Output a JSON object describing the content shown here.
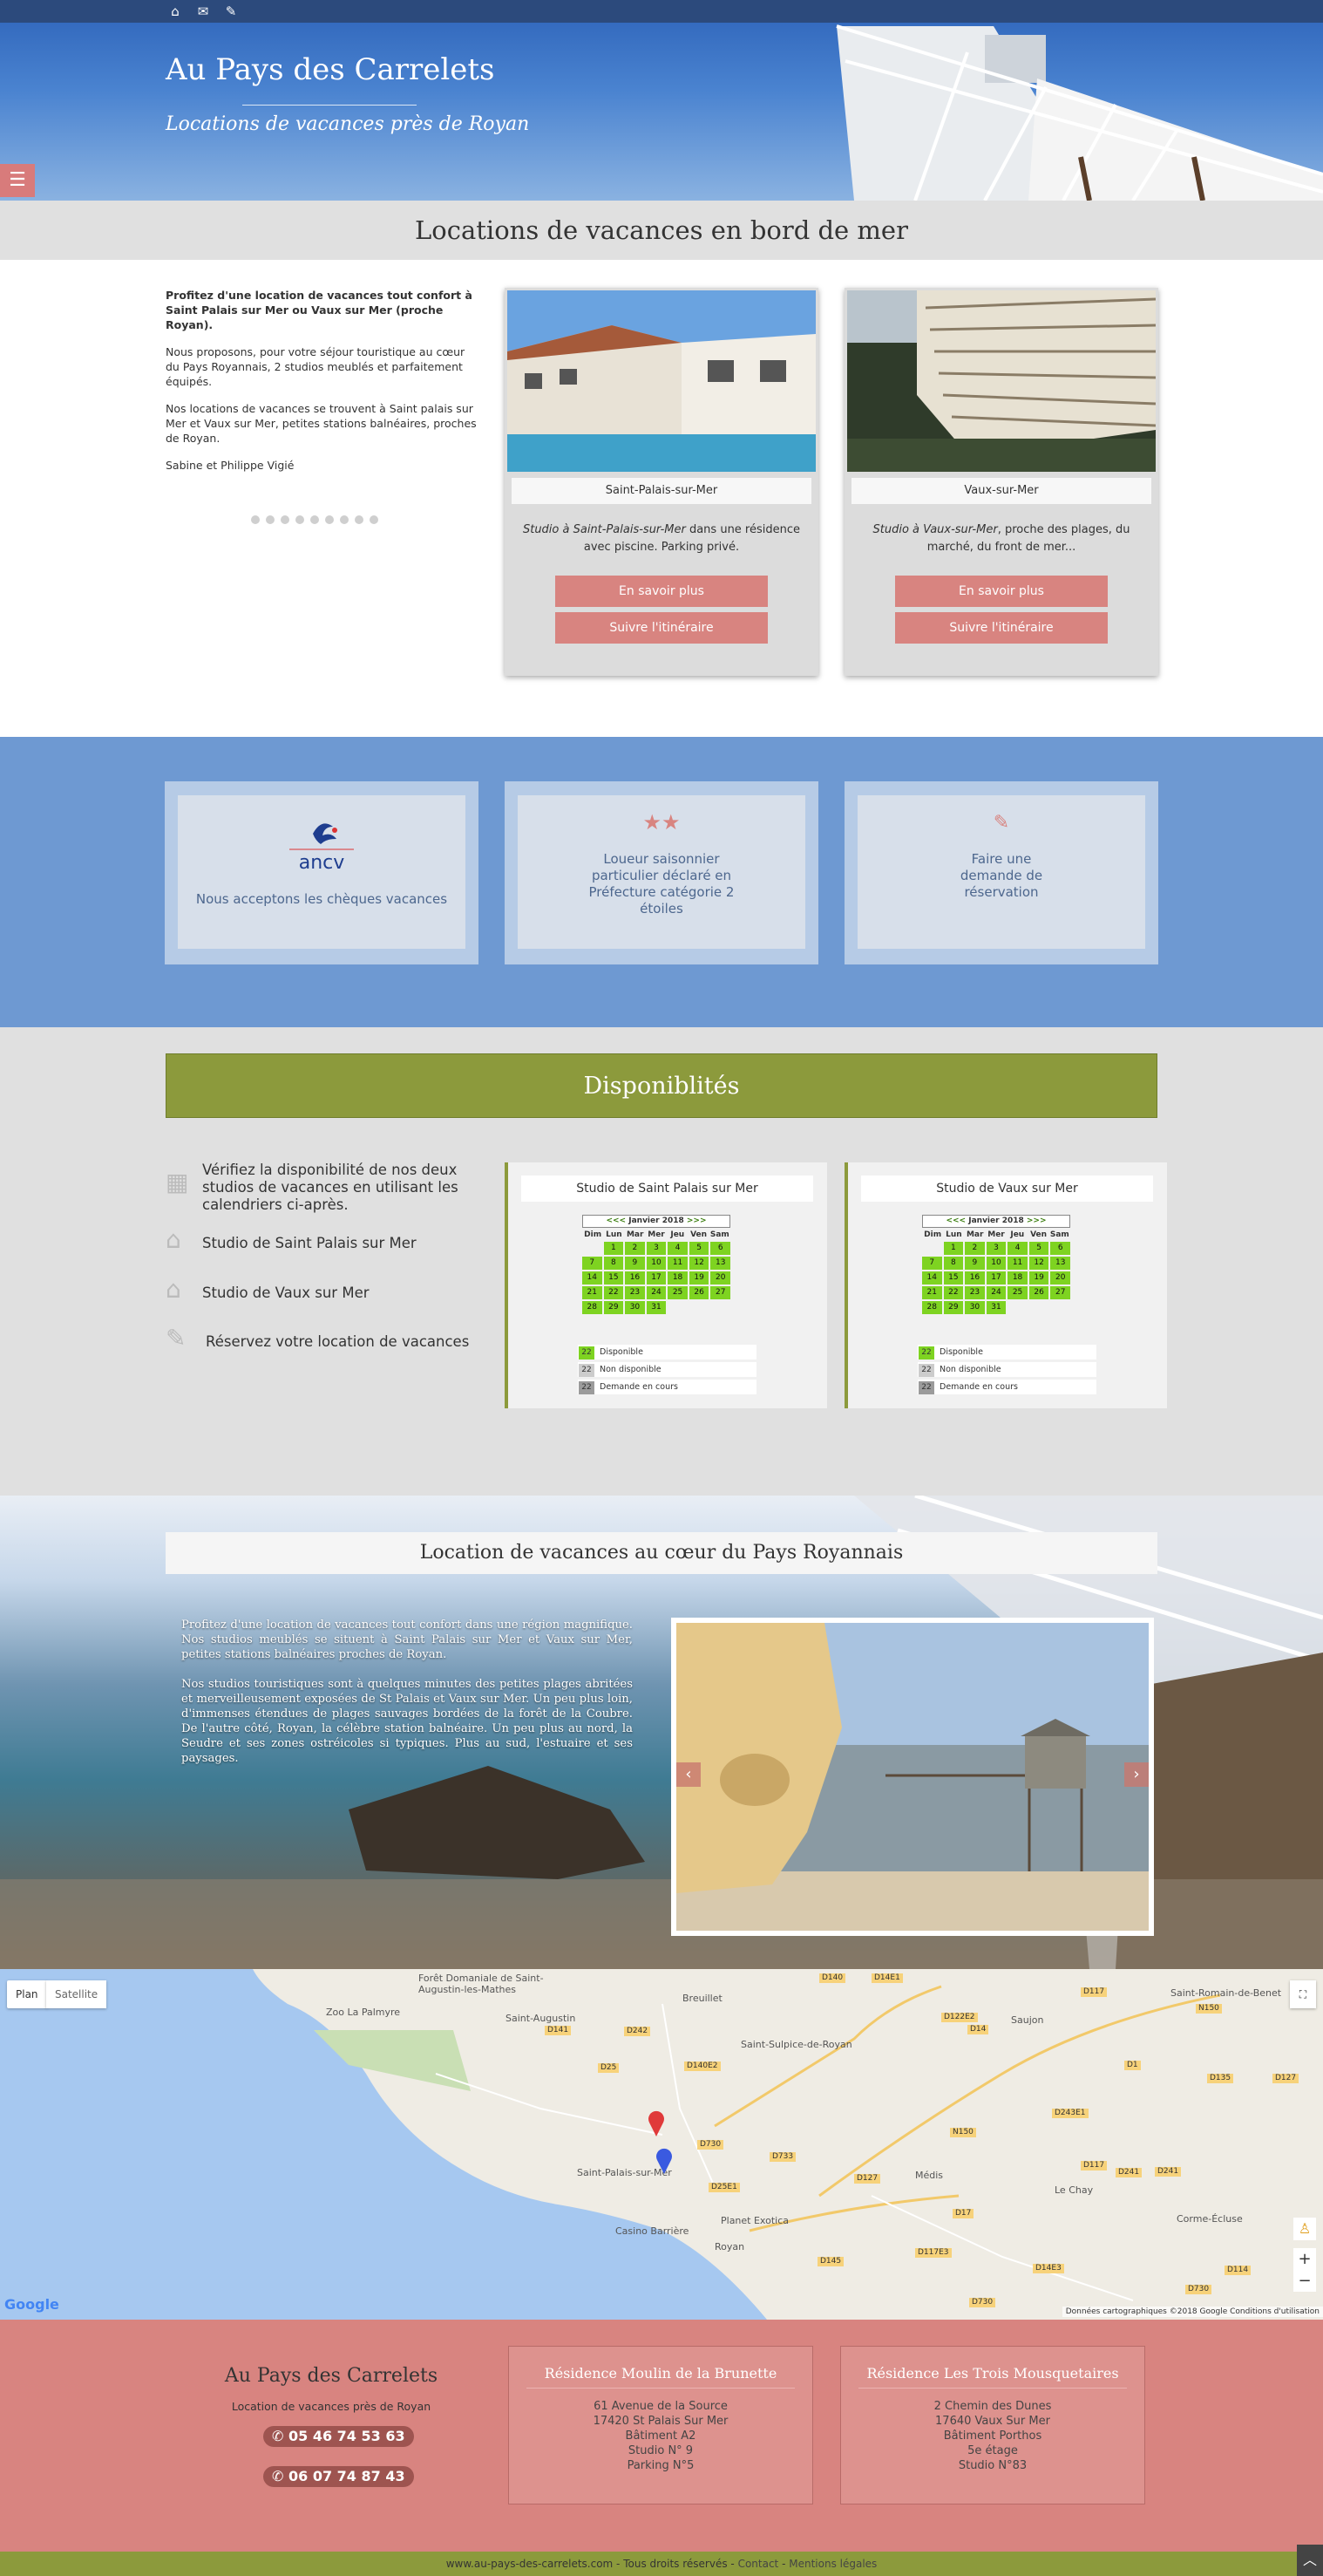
{
  "topbar": {
    "icons": [
      "home-icon",
      "envelope-icon",
      "edit-icon"
    ]
  },
  "hero": {
    "title": "Au Pays des Carrelets",
    "subtitle": "Locations de vacances près de Royan",
    "menu_icon": "hamburger-icon"
  },
  "section1": {
    "title": "Locations de vacances en bord de mer",
    "intro_lead": "Profitez d'une location de vacances tout confort à Saint Palais sur Mer ou Vaux sur Mer (proche Royan).",
    "intro_p2": "Nous proposons, pour votre séjour touristique au cœur du Pays Royannais, 2 studios meublés et parfaitement équipés.",
    "intro_p3": "Nos locations de vacances se trouvent à Saint palais sur Mer et Vaux sur Mer, petites stations balnéaires, proches de Royan.",
    "signature": "Sabine et Philippe Vigié",
    "cards": [
      {
        "label": "Saint-Palais-sur-Mer",
        "desc_em": "Studio à Saint-Palais-sur-Mer",
        "desc": " dans une résidence avec piscine. Parking privé.",
        "btn1": "En savoir plus",
        "btn2": "Suivre l'itinéraire"
      },
      {
        "label": "Vaux-sur-Mer",
        "desc_em": "Studio à Vaux-sur-Mer",
        "desc": ", proche des plages, du marché, du front de mer...",
        "btn1": "En savoir plus",
        "btn2": "Suivre l'itinéraire"
      }
    ]
  },
  "section2": {
    "cards": [
      {
        "icon": "ancv-logo",
        "logo_text": "ancv",
        "text": "Nous acceptons les chèques vacances"
      },
      {
        "icon": "stars-icon",
        "text": "Loueur saisonnier particulier déclaré en Préfecture catégorie 2 étoiles"
      },
      {
        "icon": "edit-icon",
        "text": "Faire une demande de réservation"
      }
    ]
  },
  "section3": {
    "title": "Disponiblités",
    "items": [
      {
        "icon": "calendar-icon",
        "text": "Vérifiez la disponibilité de nos deux studios de vacances en utilisant les calendriers ci-après."
      },
      {
        "icon": "home-icon",
        "text": "Studio de Saint Palais sur Mer"
      },
      {
        "icon": "home-icon",
        "text": "Studio de Vaux sur Mer"
      },
      {
        "icon": "edit-icon",
        "text": "Réservez votre location de vacances"
      }
    ],
    "calendars": [
      {
        "title": "Studio de Saint Palais sur Mer",
        "prev": "<<<",
        "month": "Janvier 2018",
        "next": ">>>"
      },
      {
        "title": "Studio de Vaux sur Mer",
        "prev": "<<<",
        "month": "Janvier 2018",
        "next": ">>>"
      }
    ],
    "weekdays": [
      "Dim",
      "Lun",
      "Mar",
      "Mer",
      "Jeu",
      "Ven",
      "Sam"
    ],
    "legend": [
      {
        "num": "22",
        "label": "Disponible",
        "color": "#7ed321"
      },
      {
        "num": "22",
        "label": "Non disponible",
        "color": "#cccccc"
      },
      {
        "num": "22",
        "label": "Demande en cours",
        "color": "#9b9b9b"
      }
    ]
  },
  "section4": {
    "title": "Location de vacances au cœur du Pays Royannais",
    "p1": "Profitez d'une location de vacances tout confort dans une région magnifique. Nos studios meublés se situent à Saint Palais sur Mer et Vaux sur Mer, petites stations balnéaires proches de Royan.",
    "p2": "Nos studios touristiques sont à quelques minutes des petites plages abritées et merveilleusement exposées de St Palais et Vaux sur Mer. Un peu plus loin, d'immenses étendues de plages sauvages bordées de la forêt de la Coubre. De l'autre côté, Royan, la célèbre station balnéaire. Un peu plus au nord, la Seudre et ses zones ostréicoles si typiques. Plus au sud, l'estuaire et ses paysages.",
    "prev": "‹",
    "next": "›"
  },
  "map": {
    "plan": "Plan",
    "satellite": "Satellite",
    "places": [
      {
        "text": "Forêt Domaniale de Saint-Augustin-les-Mathes"
      },
      {
        "text": "Zoo La Palmyre"
      },
      {
        "text": "Saint-Augustin"
      },
      {
        "text": "Breuillet"
      },
      {
        "text": "Saint-Sulpice-de-Royan"
      },
      {
        "text": "Saujon"
      },
      {
        "text": "Saint-Romain-de-Benet"
      },
      {
        "text": "Saint-Palais-sur-Mer"
      },
      {
        "text": "Médis"
      },
      {
        "text": "Le Chay"
      },
      {
        "text": "Corme-Écluse"
      },
      {
        "text": "Planet Exotica"
      },
      {
        "text": "Casino Barrière"
      },
      {
        "text": "Royan"
      }
    ],
    "roads": [
      "D140",
      "D14E1",
      "D117",
      "N150",
      "D14",
      "D122E2",
      "D25",
      "D141",
      "D242",
      "D140E2",
      "D733",
      "N150",
      "D1",
      "D135",
      "D127",
      "D243E1",
      "D117",
      "D241",
      "D241",
      "D17",
      "D117E3",
      "D114",
      "D145",
      "D127",
      "D730",
      "D25E1",
      "D14E3",
      "D730",
      "D730"
    ],
    "google": "Google",
    "attribution": "Données cartographiques ©2018 Google",
    "terms": "Conditions d'utilisation"
  },
  "footer": {
    "name": "Au Pays des Carrelets",
    "subtitle": "Location de vacances près de Royan",
    "tel1": "05 46 74 53 63",
    "tel2": "06 07 74 87 43",
    "box1": {
      "title": "Résidence Moulin de la Brunette",
      "lines": [
        "61 Avenue de la Source",
        "17420 St Palais Sur Mer",
        "Bâtiment A2",
        "Studio N° 9",
        "Parking N°5"
      ]
    },
    "box2": {
      "title": "Résidence Les Trois Mousquetaires",
      "lines": [
        "2 Chemin des Dunes",
        "17640 Vaux Sur Mer",
        "Bâtiment Porthos",
        "5e étage",
        "Studio N°83"
      ]
    },
    "bottom_site": "www.au-pays-des-carrelets.com",
    "bottom_sep": " - ",
    "bottom_rights": "Tous droits réservés",
    "bottom_contact": "Contact",
    "bottom_legal": "Mentions légales"
  }
}
